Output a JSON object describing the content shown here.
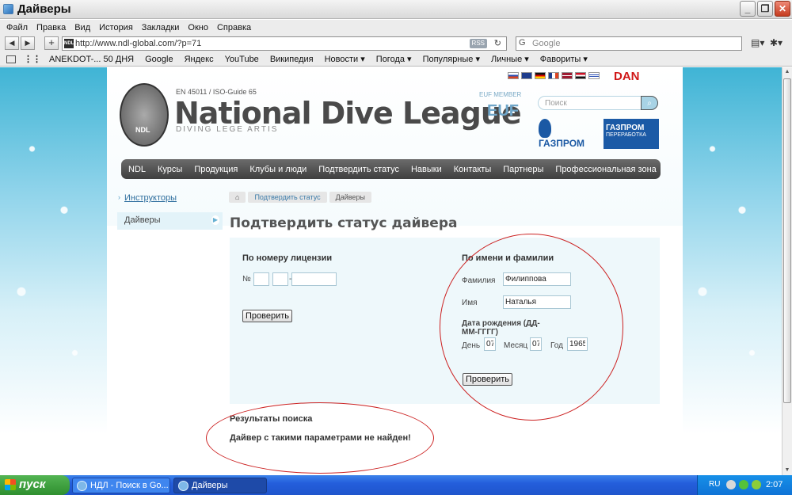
{
  "window": {
    "title": "Дайверы"
  },
  "menu": [
    "Файл",
    "Правка",
    "Вид",
    "История",
    "Закладки",
    "Окно",
    "Справка"
  ],
  "address": {
    "url": "http://www.ndl-global.com/?p=71",
    "rss": "RSS",
    "search_placeholder": "Google",
    "search_engine_glyph": "G"
  },
  "bookmarks": [
    "ANEKDOT-... 50 ДНЯ",
    "Google",
    "Яндекс",
    "YouTube",
    "Википедия",
    "Новости ▾",
    "Погода ▾",
    "Популярные ▾",
    "Личные ▾",
    "Фавориты ▾"
  ],
  "site": {
    "iso": "EN 45011 / ISO-Guide 65",
    "brand": "National Dive League",
    "tagline": "DIVING LEGE ARTIS",
    "logo_text": "NDL",
    "euf_member": "EUF MEMBER",
    "euf": "EUF",
    "dan": "DAN",
    "search_placeholder": "Поиск",
    "gazprom1": "ГАЗПРОМ",
    "gazprom2": "ГАЗПРОМ",
    "gazprom2_sub": "ПЕРЕРАБОТКА",
    "nav": [
      "NDL",
      "Курсы",
      "Продукция",
      "Клубы и люди",
      "Подтвердить статус",
      "Навыки",
      "Контакты",
      "Партнеры",
      "Профессиональная зона"
    ]
  },
  "sidebar": {
    "items": [
      "Инструкторы",
      "Дайверы"
    ]
  },
  "breadcrumb": [
    "⌂",
    "Подтвердить статус",
    "Дайверы"
  ],
  "page_title": "Подтвердить статус дайвера",
  "form_license": {
    "title": "По номеру лицензии",
    "number_label": "№",
    "dash": "-",
    "check_button": "Проверить"
  },
  "form_name": {
    "title": "По имени и фамилии",
    "surname_label": "Фамилия",
    "surname_value": "Филиппова",
    "name_label": "Имя",
    "name_value": "Наталья",
    "dob_label": "Дата рождения (ДД-ММ-ГГГГ)",
    "day_label": "День",
    "day_value": "07",
    "month_label": "Месяц",
    "month_value": "07",
    "year_label": "Год",
    "year_value": "1965",
    "check_button": "Проверить"
  },
  "results": {
    "title": "Результаты поиска",
    "message": "Дайвер с такими параметрами не найден!"
  },
  "taskbar": {
    "start": "пуск",
    "tasks": [
      "НДЛ - Поиск в Go...",
      "Дайверы"
    ],
    "lang": "RU",
    "clock": "2:07"
  }
}
